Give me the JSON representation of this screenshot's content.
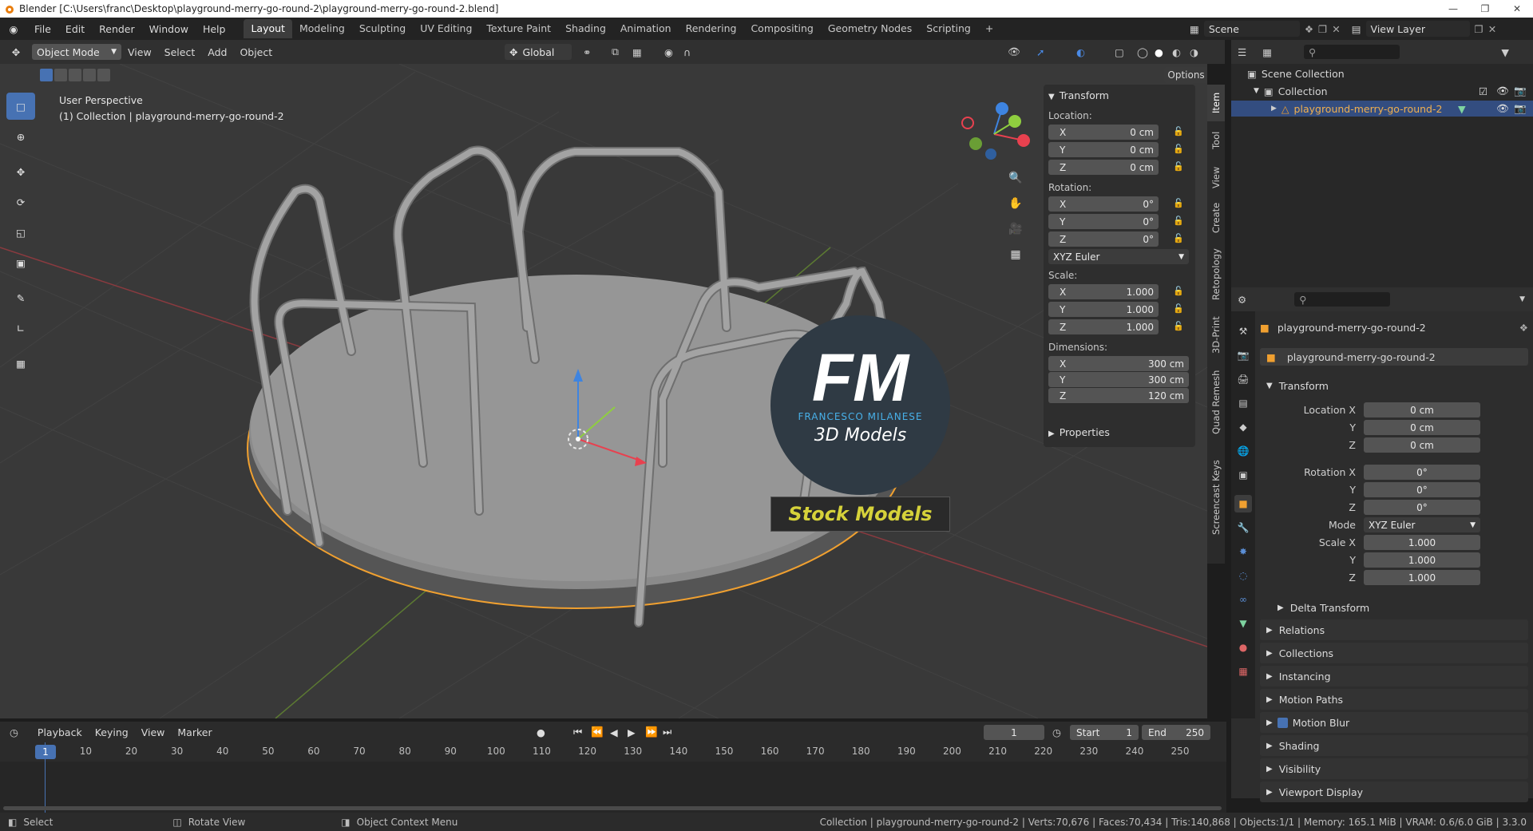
{
  "window": {
    "title": "Blender [C:\\Users\\franc\\Desktop\\playground-merry-go-round-2\\playground-merry-go-round-2.blend]"
  },
  "menu": [
    "File",
    "Edit",
    "Render",
    "Window",
    "Help"
  ],
  "workspaces": [
    "Layout",
    "Modeling",
    "Sculpting",
    "UV Editing",
    "Texture Paint",
    "Shading",
    "Animation",
    "Rendering",
    "Compositing",
    "Geometry Nodes",
    "Scripting"
  ],
  "active_workspace": "Layout",
  "scene": "Scene",
  "view_layer": "View Layer",
  "viewport_header": {
    "mode": "Object Mode",
    "menus": [
      "View",
      "Select",
      "Add",
      "Object"
    ],
    "orientation": "Global",
    "options": "Options"
  },
  "overlay_text": {
    "line1": "User Perspective",
    "line2": "(1) Collection | playground-merry-go-round-2"
  },
  "npanel": {
    "header": "Transform",
    "location_label": "Location:",
    "location": [
      {
        "axis": "X",
        "value": "0 cm"
      },
      {
        "axis": "Y",
        "value": "0 cm"
      },
      {
        "axis": "Z",
        "value": "0 cm"
      }
    ],
    "rotation_label": "Rotation:",
    "rotation": [
      {
        "axis": "X",
        "value": "0°"
      },
      {
        "axis": "Y",
        "value": "0°"
      },
      {
        "axis": "Z",
        "value": "0°"
      }
    ],
    "rotation_mode": "XYZ Euler",
    "scale_label": "Scale:",
    "scale": [
      {
        "axis": "X",
        "value": "1.000"
      },
      {
        "axis": "Y",
        "value": "1.000"
      },
      {
        "axis": "Z",
        "value": "1.000"
      }
    ],
    "dimensions_label": "Dimensions:",
    "dimensions": [
      {
        "axis": "X",
        "value": "300 cm"
      },
      {
        "axis": "Y",
        "value": "300 cm"
      },
      {
        "axis": "Z",
        "value": "120 cm"
      }
    ],
    "properties": "Properties"
  },
  "sidebar_tabs": [
    "Item",
    "Tool",
    "View",
    "Create",
    "Retopology",
    "3D-Print",
    "Quad Remesh",
    "Screencast Keys"
  ],
  "watermark": {
    "logo": "FM",
    "name": "FRANCESCO MILANESE",
    "sub": "3D Models",
    "banner": "Stock Models"
  },
  "outliner": {
    "scene_collection": "Scene Collection",
    "collection": "Collection",
    "object": "playground-merry-go-round-2"
  },
  "properties": {
    "object_name": "playground-merry-go-round-2",
    "data_name": "playground-merry-go-round-2",
    "transform_header": "Transform",
    "location_x_label": "Location X",
    "rotation_x_label": "Rotation X",
    "scale_x_label": "Scale X",
    "y_label": "Y",
    "z_label": "Z",
    "mode_label": "Mode",
    "mode_value": "XYZ Euler",
    "location": [
      "0 cm",
      "0 cm",
      "0 cm"
    ],
    "rotation": [
      "0°",
      "0°",
      "0°"
    ],
    "scale": [
      "1.000",
      "1.000",
      "1.000"
    ],
    "delta_transform": "Delta Transform",
    "panels": [
      "Relations",
      "Collections",
      "Instancing",
      "Motion Paths",
      "Motion Blur",
      "Shading",
      "Visibility",
      "Viewport Display"
    ]
  },
  "timeline": {
    "menus": [
      "Playback",
      "Keying",
      "View",
      "Marker"
    ],
    "current_frame": "1",
    "start_label": "Start",
    "start": "1",
    "end_label": "End",
    "end": "250",
    "ticks": [
      "1",
      "10",
      "20",
      "30",
      "40",
      "50",
      "60",
      "70",
      "80",
      "90",
      "100",
      "110",
      "120",
      "130",
      "140",
      "150",
      "160",
      "170",
      "180",
      "190",
      "200",
      "210",
      "220",
      "230",
      "240",
      "250"
    ]
  },
  "statusbar": {
    "select": "Select",
    "rotate": "Rotate View",
    "context": "Object Context Menu",
    "stats": "Collection | playground-merry-go-round-2 | Verts:70,676 | Faces:70,434 | Tris:140,868 | Objects:1/1 | Memory: 165.1 MiB | VRAM: 0.6/6.0 GiB | 3.3.0"
  },
  "colors": {
    "accent": "#4772b3",
    "selection_outline": "#f0a030",
    "axis_x": "#e8414f",
    "axis_y": "#8fce3f",
    "axis_z": "#3e84e0",
    "watermark_banner_text": "#d6d23a"
  }
}
